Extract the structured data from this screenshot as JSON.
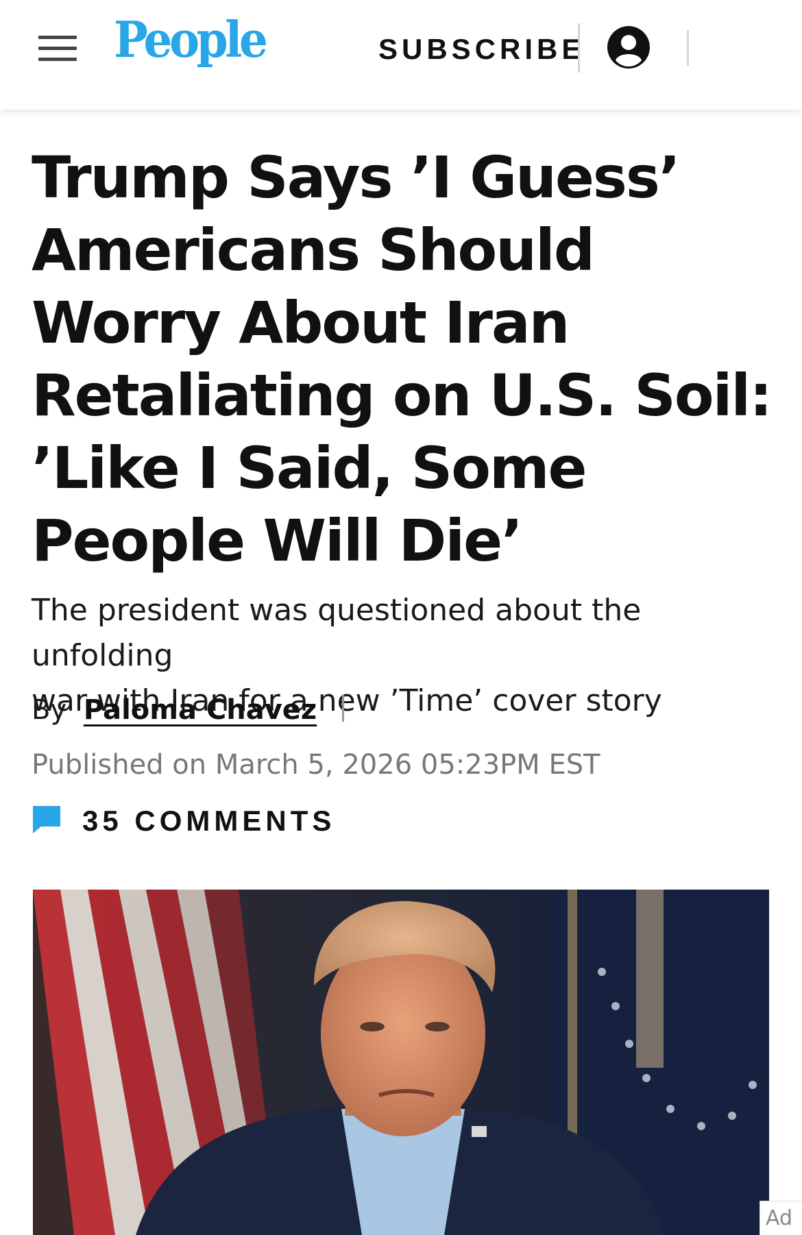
{
  "header": {
    "logo_text": "People",
    "logo_color": "#29a6e8",
    "subscribe_label": "SUBSCRIBE",
    "menu_icon": "hamburger-menu-icon",
    "account_icon": "account-circle-icon"
  },
  "article": {
    "headline_lines": [
      "Trump Says ’I Guess’",
      "Americans Should",
      "Worry About Iran",
      "Retaliating on U.S. Soil:",
      "’Like I Said, Some",
      "People Will Die’"
    ],
    "dek_lines": [
      "The president was questioned about the unfolding",
      "war with Iran for a new ’Time’ cover story"
    ],
    "byline_prefix": "By",
    "author": "Paloma Chavez",
    "published": "Published on March 5, 2026 05:23PM EST",
    "comments_label": "35  COMMENTS",
    "comments_icon": "comment-bubble-icon",
    "accent_color": "#29a6e8"
  },
  "ad": {
    "label": "Ad"
  }
}
